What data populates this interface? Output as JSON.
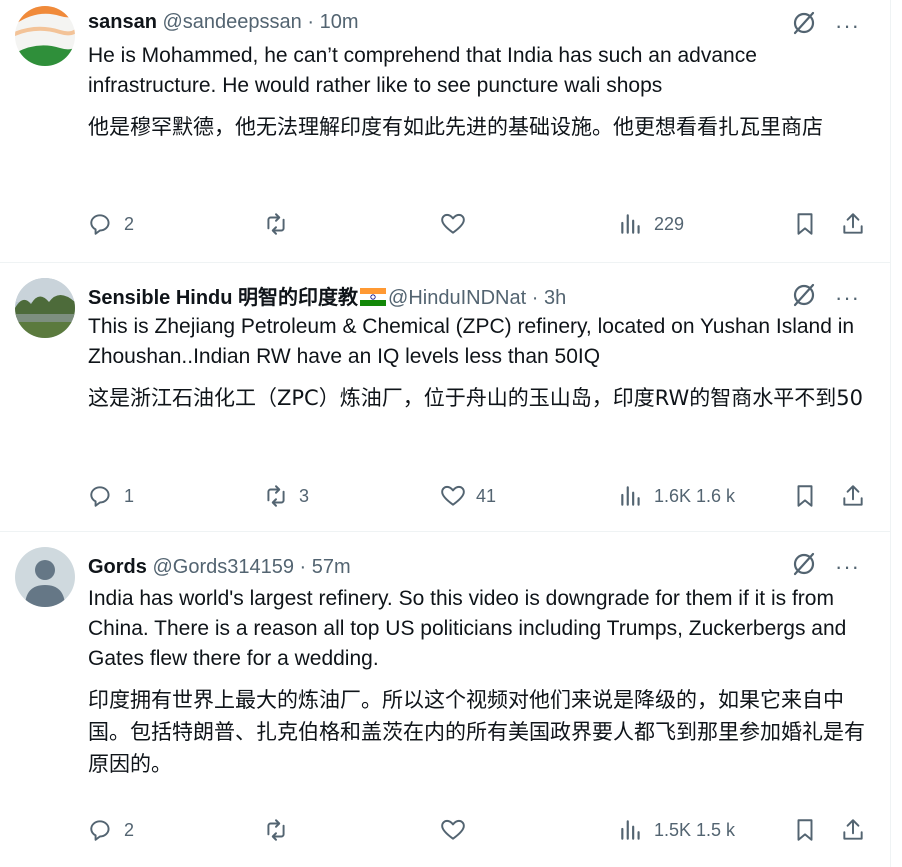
{
  "tweets": [
    {
      "name": "sansan",
      "handle": "@sandeepssan",
      "dot": "·",
      "time": "10m",
      "text_en": "He is Mohammed, he can’t comprehend that India has such an advance infrastructure. He would rather like to see puncture wali shops",
      "text_zh": "他是穆罕默德，他无法理解印度有如此先进的基础设施。他更想看看扎瓦里商店",
      "replies": "2",
      "reposts": "",
      "likes": "",
      "views": "229"
    },
    {
      "name": "Sensible Hindu 明智的印度教",
      "handle": "@HinduINDNat",
      "dot": "·",
      "time": "3h",
      "text_en": "This is Zhejiang Petroleum & Chemical (ZPC) refinery, located on Yushan Island in Zhoushan..Indian RW have an IQ levels less than 50IQ",
      "text_zh": "这是浙江石油化工（ZPC）炼油厂，位于舟山的玉山岛，印度RW的智商水平不到50",
      "replies": "1",
      "reposts": "3",
      "likes": "41",
      "views": "1.6K 1.6 k"
    },
    {
      "name": "Gords",
      "handle": "@Gords314159",
      "dot": "·",
      "time": "57m",
      "text_en": "India has world's largest refinery. So this video is downgrade for them if it is from China.  There is a reason all top US politicians including Trumps, Zuckerbergs and Gates flew there for a wedding.",
      "text_zh": "印度拥有世界上最大的炼油厂。所以这个视频对他们来说是降级的，如果它来自中国。包括特朗普、扎克伯格和盖茨在内的所有美国政界要人都飞到那里参加婚礼是有原因的。",
      "replies": "2",
      "reposts": "",
      "likes": "",
      "views": "1.5K 1.5 k"
    }
  ],
  "icons": {
    "reply": "reply-icon",
    "repost": "repost-icon",
    "like": "heart-icon",
    "views": "views-icon",
    "bookmark": "bookmark-icon",
    "share": "share-icon",
    "grok": "grok-icon",
    "more": "more-icon",
    "flag": "india-flag-icon"
  },
  "colors": {
    "text": "#0f1419",
    "secondary": "#536471",
    "divider": "#eff3f4"
  },
  "more_glyph": "···"
}
